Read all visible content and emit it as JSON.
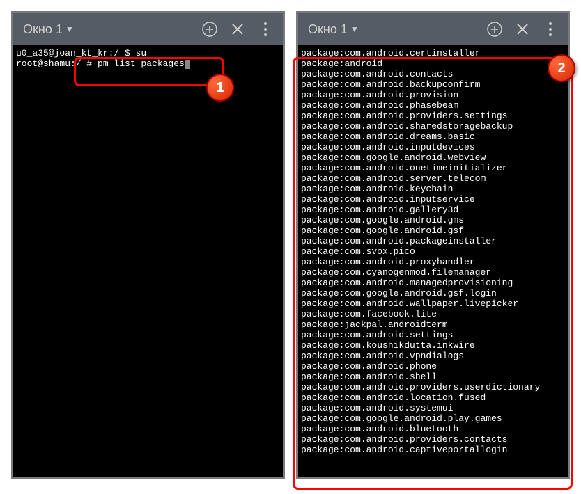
{
  "window1": {
    "title": "Окно 1",
    "terminal": {
      "line1_user": "u0_a35@joan_kt_kr:/ $ su",
      "line2_prompt": "root@shamu:/ # pm list packages"
    }
  },
  "window2": {
    "title": "Окно 1",
    "packages": [
      "package:com.android.certinstaller",
      "package:android",
      "package:com.android.contacts",
      "package:com.android.backupconfirm",
      "package:com.android.provision",
      "package:com.android.phasebeam",
      "package:com.android.providers.settings",
      "package:com.android.sharedstoragebackup",
      "package:com.android.dreams.basic",
      "package:com.android.inputdevices",
      "package:com.google.android.webview",
      "package:com.android.onetimeinitializer",
      "package:com.android.server.telecom",
      "package:com.android.keychain",
      "package:com.android.inputservice",
      "package:com.android.gallery3d",
      "package:com.google.android.gms",
      "package:com.google.android.gsf",
      "package:com.android.packageinstaller",
      "package:com.svox.pico",
      "package:com.android.proxyhandler",
      "package:com.cyanogenmod.filemanager",
      "package:com.android.managedprovisioning",
      "package:com.google.android.gsf.login",
      "package:com.android.wallpaper.livepicker",
      "package:com.facebook.lite",
      "package:jackpal.androidterm",
      "package:com.android.settings",
      "package:com.koushikdutta.inkwire",
      "package:com.android.vpndialogs",
      "package:com.android.phone",
      "package:com.android.shell",
      "package:com.android.providers.userdictionary",
      "package:com.android.location.fused",
      "package:com.android.systemui",
      "package:com.google.android.play.games",
      "package:com.android.bluetooth",
      "package:com.android.providers.contacts",
      "package:com.android.captiveportallogin"
    ]
  },
  "badges": {
    "b1": "1",
    "b2": "2"
  }
}
